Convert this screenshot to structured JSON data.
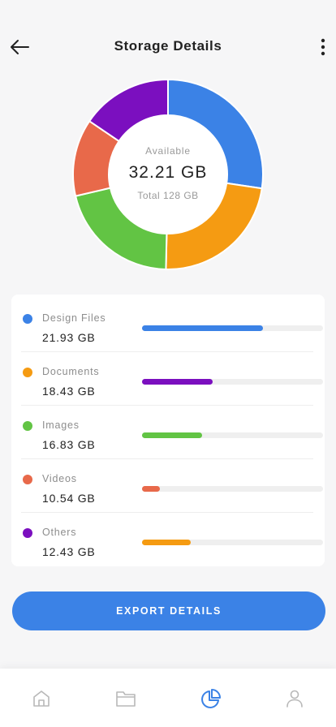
{
  "header": {
    "title": "Storage Details"
  },
  "summary": {
    "available_label": "Available",
    "available_value": "32.21 GB",
    "total_label": "Total 128 GB"
  },
  "chart_data": {
    "type": "pie",
    "categories": [
      "Design Files",
      "Documents",
      "Images",
      "Videos",
      "Others"
    ],
    "values": [
      21.93,
      18.43,
      16.83,
      10.54,
      12.43
    ],
    "colors": [
      "#3b82e6",
      "#f59b12",
      "#62c444",
      "#e8694a",
      "#7b0fbf"
    ]
  },
  "breakdown": [
    {
      "name": "Design Files",
      "size": "21.93 GB",
      "dot_color": "#3b82e6",
      "bar_color": "#3b82e6",
      "bar_fraction": 0.67
    },
    {
      "name": "Documents",
      "size": "18.43 GB",
      "dot_color": "#f59b12",
      "bar_color": "#7b0fbf",
      "bar_fraction": 0.39
    },
    {
      "name": "Images",
      "size": "16.83 GB",
      "dot_color": "#62c444",
      "bar_color": "#62c444",
      "bar_fraction": 0.33
    },
    {
      "name": "Videos",
      "size": "10.54 GB",
      "dot_color": "#e8694a",
      "bar_color": "#e8694a",
      "bar_fraction": 0.1
    },
    {
      "name": "Others",
      "size": "12.43 GB",
      "dot_color": "#7b0fbf",
      "bar_color": "#f59b12",
      "bar_fraction": 0.27
    }
  ],
  "actions": {
    "export_label": "EXPORT DETAILS"
  },
  "nav": {
    "items": [
      {
        "icon": "home-icon",
        "active": false
      },
      {
        "icon": "folder-icon",
        "active": false
      },
      {
        "icon": "pie-chart-icon",
        "active": true
      },
      {
        "icon": "user-icon",
        "active": false
      }
    ],
    "active_color": "#3b82e6",
    "inactive_color": "#b8b8b8"
  },
  "theme": {
    "accent": "#3b82e6",
    "background": "#f6f6f7"
  }
}
